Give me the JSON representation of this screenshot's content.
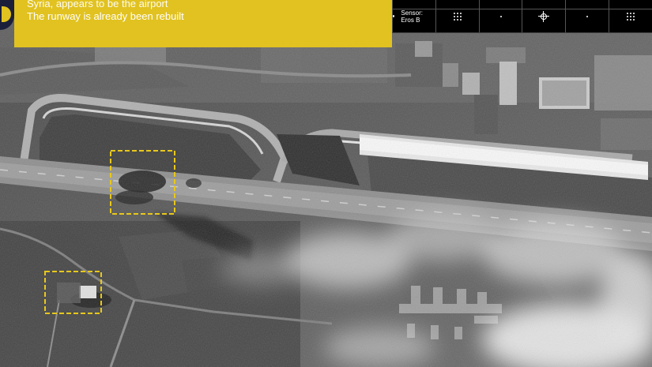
{
  "caption": {
    "title": "Syria, appears to be the airport",
    "text": "The runway is already been rebuilt"
  },
  "infobar": {
    "sensor": "Sensor: Eros B",
    "icons": [
      "grid-icon",
      "dot-icon",
      "crosshair-icon",
      "dot-icon",
      "grid-icon"
    ]
  },
  "colors": {
    "caption_bg": "#e1c220",
    "caption_text": "#ffffff",
    "infobar_bg": "#000000",
    "highlight": "#e8c81a"
  }
}
